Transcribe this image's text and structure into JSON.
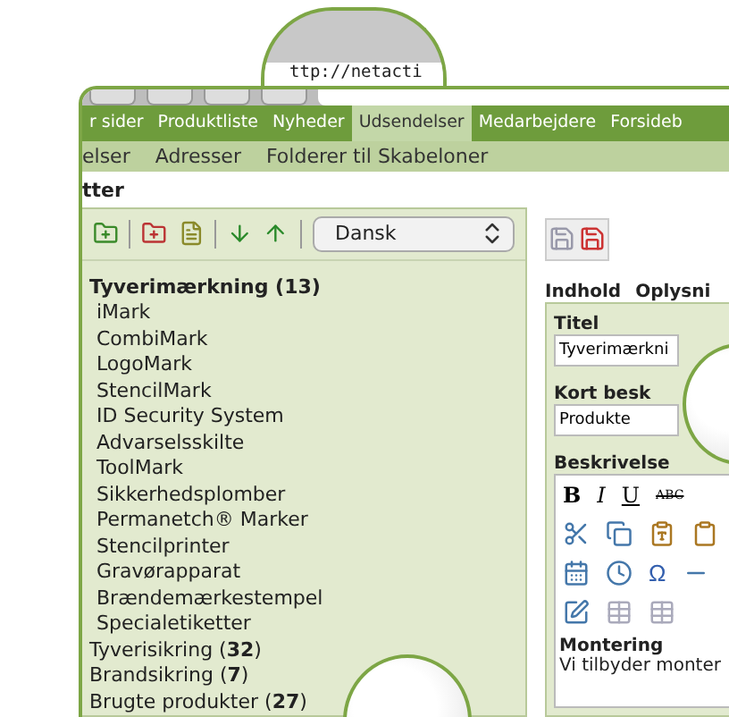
{
  "browser": {
    "url": "ttp://netacti"
  },
  "nav": {
    "tabs": [
      {
        "label": "r sider",
        "selected": false
      },
      {
        "label": "Produktliste",
        "selected": false
      },
      {
        "label": "Nyheder",
        "selected": false
      },
      {
        "label": "Udsendelser",
        "selected": true
      },
      {
        "label": "Medarbejdere",
        "selected": false
      },
      {
        "label": "Forsideb",
        "selected": false
      }
    ]
  },
  "subnav": [
    "elser",
    "Adresser",
    "Folderer til Skabeloner"
  ],
  "heading": "tter",
  "tree": {
    "language": "Dansk",
    "items": [
      {
        "label": "Tyverimærkning (13)",
        "expanded": true,
        "children": [
          "iMark",
          "CombiMark",
          "LogoMark",
          "StencilMark",
          "ID Security System",
          "Advarselsskilte",
          "ToolMark",
          "Sikkerhedsplomber",
          "Permanetch® Marker",
          "Stencilprinter",
          "Gravørapparat",
          "Brændemærkestempel",
          "Specialetiketter"
        ]
      },
      {
        "label": "Tyverisikring (**32**)",
        "expanded": false
      },
      {
        "label": "Brandsikring (**7**)",
        "expanded": false
      },
      {
        "label": "Brugte produkter (**27**)",
        "expanded": false
      }
    ]
  },
  "editor": {
    "tabs": [
      "Indhold",
      "Oplysni"
    ],
    "fields": [
      {
        "label": "Titel",
        "value": "Tyverimærkni"
      },
      {
        "label": "Kort besk",
        "value": "Produkte"
      }
    ],
    "description_label": "Beskrivelse",
    "format_buttons": [
      {
        "label": "B",
        "kind": "bold"
      },
      {
        "label": "I",
        "kind": "italic"
      },
      {
        "label": "U",
        "kind": "underline"
      },
      {
        "label": "ABC",
        "kind": "strike"
      }
    ],
    "symbol": "Ω",
    "content_heading": "Montering",
    "content_text": "Vi tilbyder monter"
  }
}
